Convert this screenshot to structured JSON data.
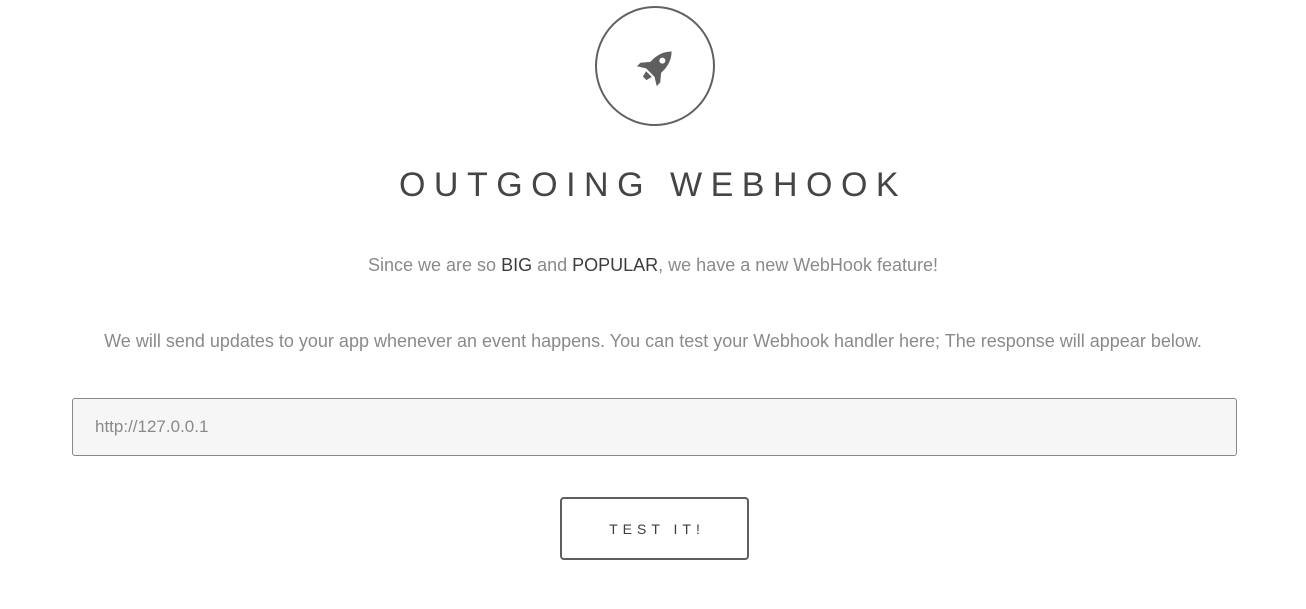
{
  "header": {
    "icon": "rocket-icon",
    "title": "OUTGOING WEBHOOK"
  },
  "intro": {
    "prefix": "Since we are so ",
    "big": "BIG",
    "and": " and ",
    "popular": "POPULAR",
    "suffix": ", we have a new WebHook feature!"
  },
  "description": "We will send updates to your app whenever an event happens. You can test your Webhook handler here; The response will appear below.",
  "form": {
    "url_placeholder": "http://127.0.0.1",
    "url_value": "",
    "submit_label": "TEST IT!"
  },
  "colors": {
    "icon": "#5f5f5f",
    "title": "#454545",
    "input_bg": "#f6f6f6"
  }
}
